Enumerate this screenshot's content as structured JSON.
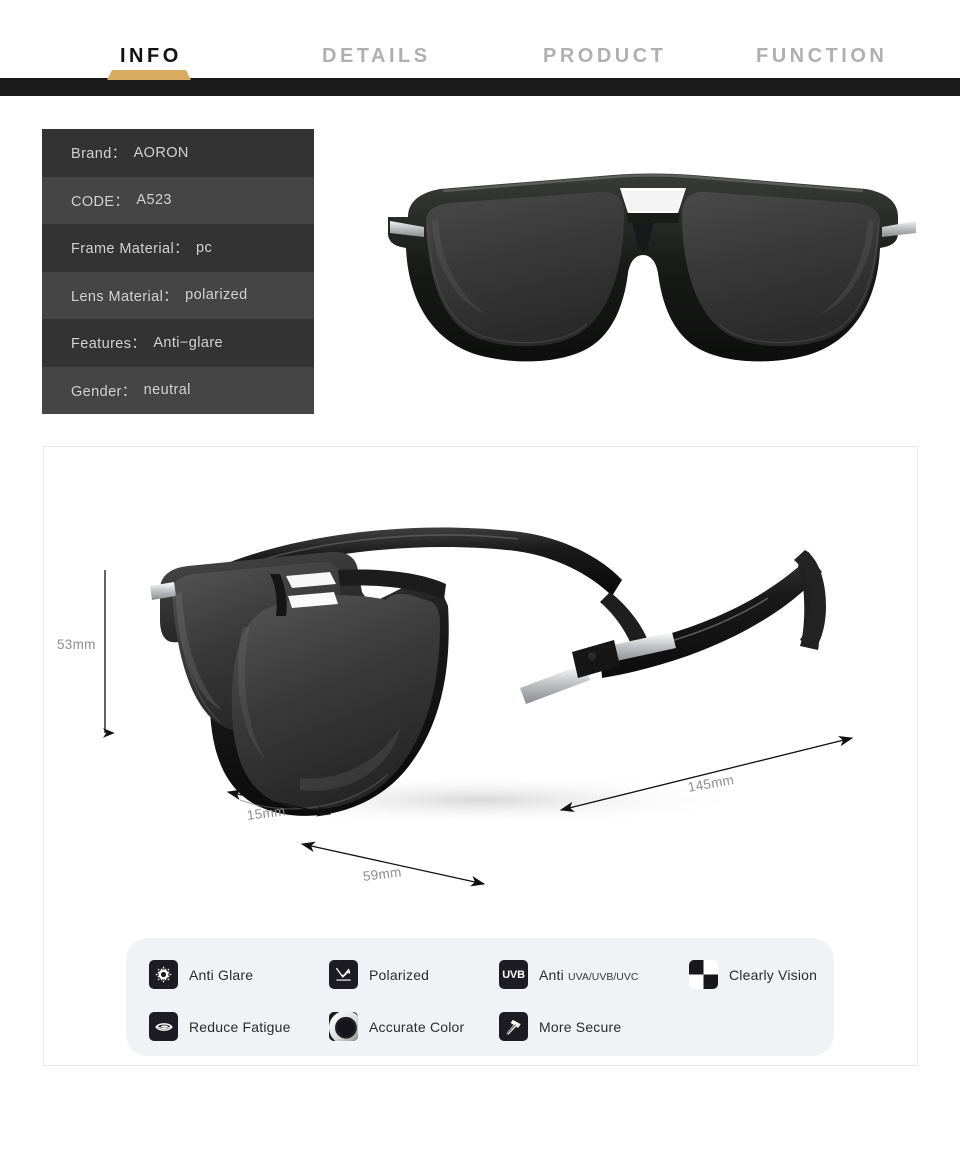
{
  "tabs": [
    {
      "label": "INFO",
      "active": true
    },
    {
      "label": "DETAILS",
      "active": false
    },
    {
      "label": "PRODUCT",
      "active": false
    },
    {
      "label": "FUNCTION",
      "active": false
    }
  ],
  "colors": {
    "accent_gold": "#d9ac62",
    "header_bar": "#1a1a1a",
    "spec_row_dark": "#333333",
    "spec_row_light": "#454545",
    "spec_text": "#d2d2d2",
    "feature_panel_bg": "#f0f2f5",
    "dim_label": "#8d8d8d"
  },
  "spec_table": [
    {
      "key": "Brand：",
      "value": "AORON"
    },
    {
      "key": "CODE：",
      "value": "A523"
    },
    {
      "key": "Frame Material：",
      "value": "pc"
    },
    {
      "key": "Lens Material：",
      "value": "polarized"
    },
    {
      "key": "Features：",
      "value": "Anti−glare"
    },
    {
      "key": "Gender：",
      "value": "neutral"
    }
  ],
  "dimensions": {
    "lens_height": "53mm",
    "bridge": "15mm",
    "lens_width": "59mm",
    "temple_length": "145mm"
  },
  "features": [
    {
      "icon": "sun-glare-icon",
      "label": "Anti Glare",
      "sub": ""
    },
    {
      "icon": "polarized-icon",
      "label": "Polarized",
      "sub": ""
    },
    {
      "icon": "uvb-badge-icon",
      "label": "Anti ",
      "sub": "UVA/UVB/UVC"
    },
    {
      "icon": "checkerboard-icon",
      "label": "Clearly Vision",
      "sub": ""
    },
    {
      "icon": "eye-icon",
      "label": "Reduce Fatigue",
      "sub": ""
    },
    {
      "icon": "color-ring-icon",
      "label": "Accurate Color",
      "sub": ""
    },
    {
      "icon": "hammer-icon",
      "label": "More Secure",
      "sub": ""
    }
  ]
}
